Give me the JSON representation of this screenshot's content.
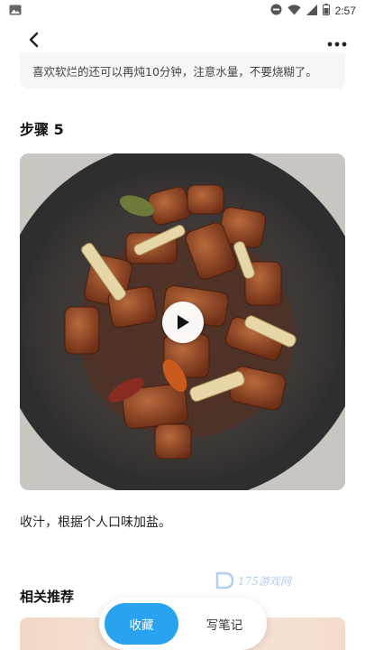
{
  "status_bar": {
    "time": "2:57",
    "icons": [
      "gallery-icon",
      "do-not-disturb-icon",
      "wifi-icon",
      "signal-icon",
      "battery-icon"
    ]
  },
  "header": {
    "back_icon": "chevron-left-icon",
    "more_icon": "more-horizontal-icon"
  },
  "previous_step": {
    "text": "喜欢软烂的还可以再炖10分钟，注意水量，不要烧糊了。"
  },
  "step": {
    "title": "步骤 5",
    "media": {
      "type": "video",
      "play_icon": "play-icon"
    },
    "description": "收汁，根据个人口味加盐。"
  },
  "watermark": {
    "text": "175游戏网"
  },
  "related": {
    "title": "相关推荐"
  },
  "bottom_actions": {
    "collect_label": "收藏",
    "note_label": "写笔记"
  },
  "colors": {
    "accent": "#29a3f0",
    "card_bg": "#f6f6f6"
  }
}
